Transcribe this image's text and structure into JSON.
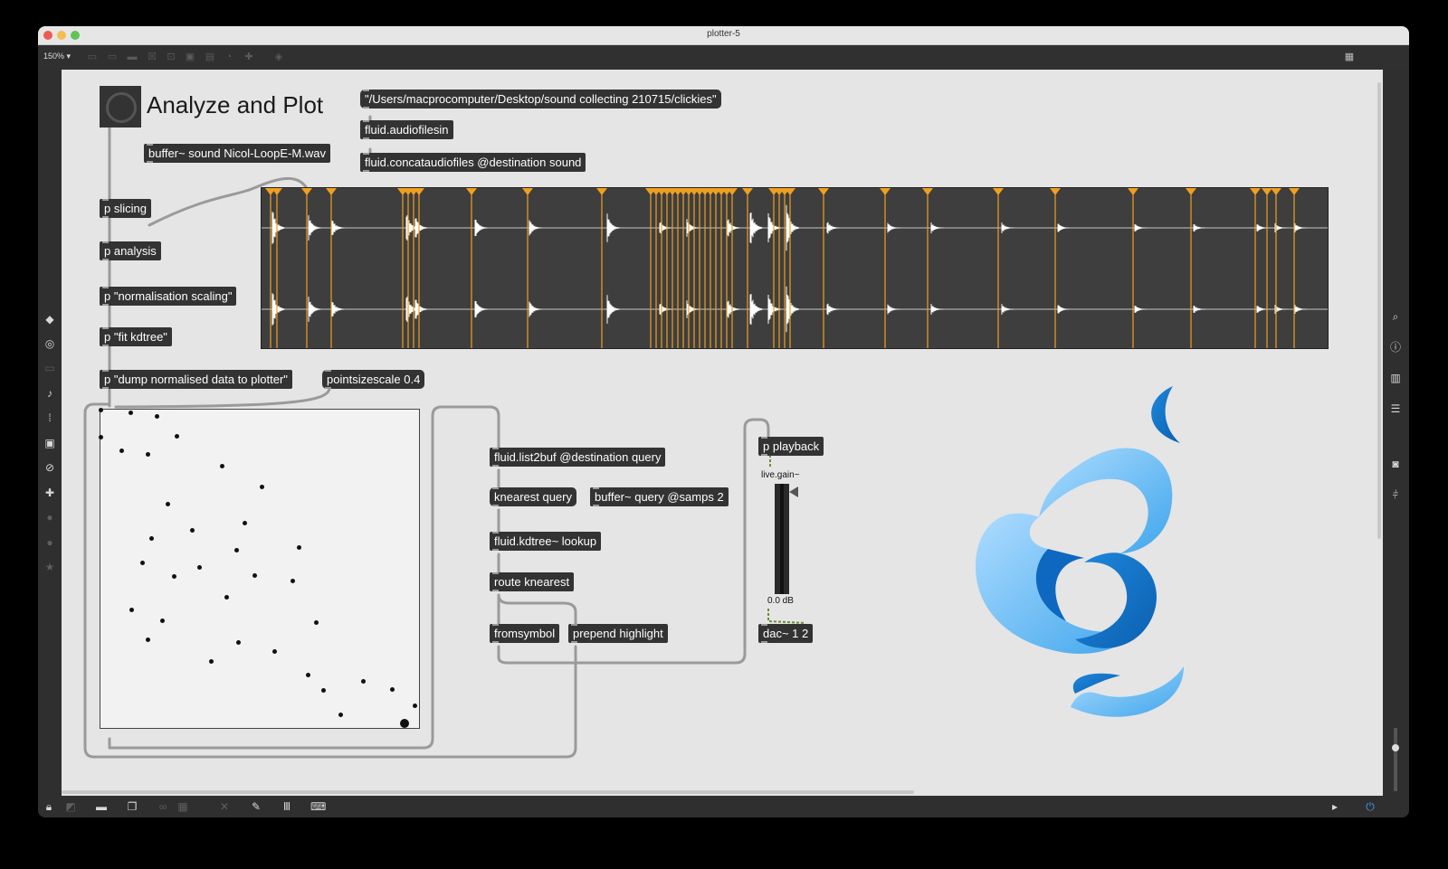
{
  "window": {
    "title": "plotter-5"
  },
  "toolbar": {
    "zoom": "150% ▾"
  },
  "patch": {
    "heading": "Analyze and Plot",
    "path_message": "\"/Users/macprocomputer/Desktop/sound collecting 210715/clickies\"",
    "audiofilesin": "fluid.audiofilesin",
    "concat": "fluid.concataudiofiles @destination sound",
    "buffer_sound": "buffer~ sound Nicol-LoopE-M.wav",
    "p_slicing": "p slicing",
    "p_analysis": "p analysis",
    "p_norm": "p \"normalisation scaling\"",
    "p_fit": "p \"fit kdtree\"",
    "p_dump": "p \"dump normalised data to plotter\"",
    "pointsize_msg": "pointsizescale 0.4",
    "list2buf": "fluid.list2buf @destination query",
    "knearest_msg": "knearest query",
    "buffer_query": "buffer~ query @samps 2",
    "kdtree_lookup": "fluid.kdtree~ lookup",
    "route": "route knearest",
    "fromsymbol": "fromsymbol",
    "prepend": "prepend highlight",
    "p_playback": "p playback",
    "livegain_label": "live.gain~",
    "livegain_value": "0.0 dB",
    "dac": "dac~ 1 2"
  },
  "waveform": {
    "slice_marker_color": "#f0a020",
    "wave_color": "#ffffff",
    "slice_count": 40
  },
  "plotter": {
    "point_count": 41,
    "highlight_color": "#111111"
  },
  "icons": {
    "left_sidebar": [
      "cube-icon",
      "target-icon",
      "panel-icon",
      "music-note-icon",
      "step-sequencer-icon",
      "image-icon",
      "paperclip-icon",
      "puzzle-icon",
      "circle-icon",
      "circle-icon-2",
      "star-icon"
    ],
    "right_sidebar": [
      "search-icon",
      "info-icon",
      "book-icon",
      "list-icon",
      "camera-icon",
      "mixer-icon"
    ],
    "bottom_bar": [
      "lock-icon",
      "edit-icon",
      "presentation-icon",
      "window-icon",
      "link-icon",
      "grid-icon",
      "eraser-icon",
      "wrench-icon",
      "piano-icon",
      "keyboard-icon",
      "play-icon",
      "power-icon"
    ]
  },
  "colors": {
    "accent_orange": "#f0a020",
    "logo_blue": "#1a8fe0",
    "logo_light": "#8fcaf5"
  }
}
